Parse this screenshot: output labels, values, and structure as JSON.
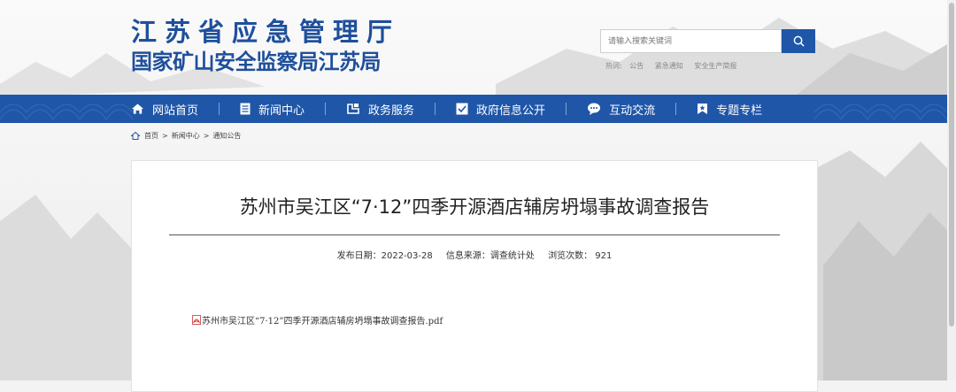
{
  "site": {
    "title_line1": "江苏省应急管理厅",
    "title_line2": "国家矿山安全监察局江苏局"
  },
  "search": {
    "placeholder": "请输入搜索关键词",
    "icon": "search-icon"
  },
  "hotwords": {
    "label": "热词:",
    "items": [
      "公告",
      "紧急通知",
      "安全生产简报"
    ]
  },
  "nav": {
    "items": [
      {
        "label": "网站首页",
        "icon": "home-icon"
      },
      {
        "label": "新闻中心",
        "icon": "document-icon"
      },
      {
        "label": "政务服务",
        "icon": "service-icon"
      },
      {
        "label": "政府信息公开",
        "icon": "info-icon"
      },
      {
        "label": "互动交流",
        "icon": "chat-icon"
      },
      {
        "label": "专题专栏",
        "icon": "bookmark-icon"
      }
    ]
  },
  "breadcrumb": {
    "items": [
      "首页",
      "新闻中心",
      "通知公告"
    ],
    "separator": ">"
  },
  "article": {
    "title": "苏州市吴江区“7·12”四季开源酒店辅房坍塌事故调查报告",
    "publish_date": "发布日期：2022-03-28",
    "source": "信息来源：调查统计处",
    "views": "浏览次数：  921",
    "attachment": "苏州市吴江区“7·12”四季开源酒店辅房坍塌事故调查报告.pdf",
    "attachment_icon": "pdf-icon"
  },
  "colors": {
    "brand": "#1f56a8",
    "logo": "#1e4f9c"
  }
}
